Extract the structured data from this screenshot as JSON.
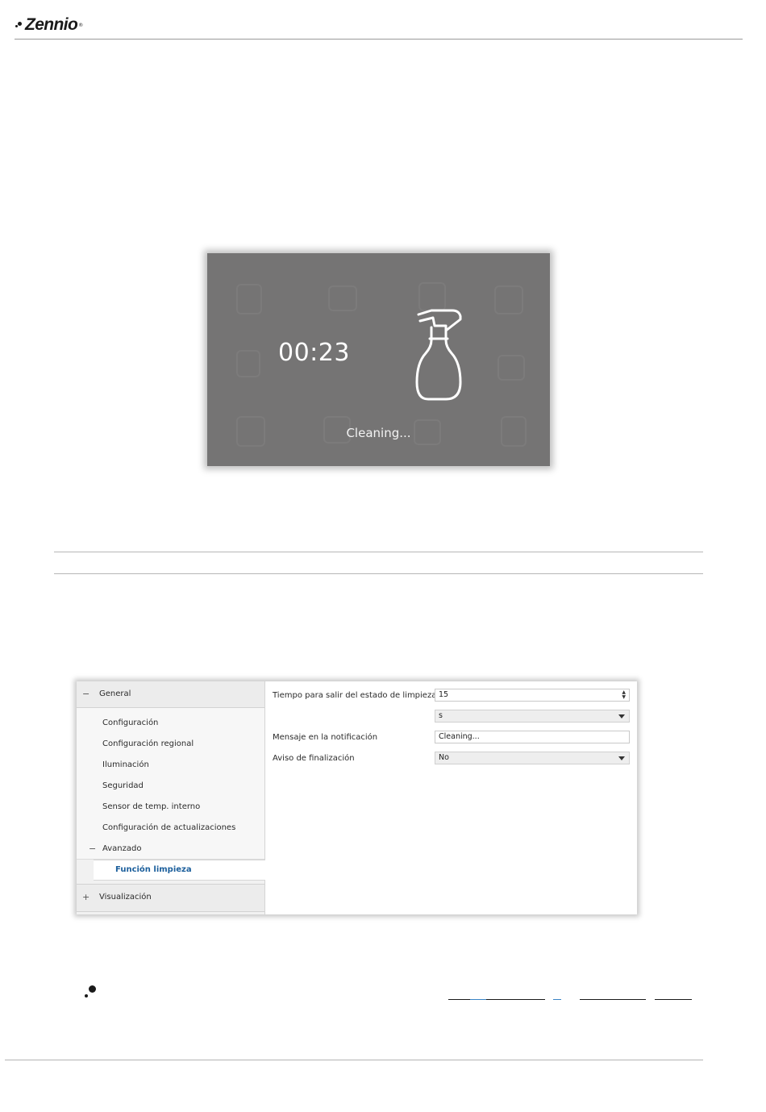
{
  "header": {
    "logo_text": "Zennio",
    "logo_mark": "®"
  },
  "cleaning_screen": {
    "countdown": "00:23",
    "message": "Cleaning...",
    "icon": "spray-bottle-icon",
    "background_color": "#757474"
  },
  "settings": {
    "tree": {
      "general": "General",
      "items": [
        "Configuración",
        "Configuración regional",
        "Iluminación",
        "Seguridad",
        "Sensor de temp. interno",
        "Configuración de actualizaciones"
      ],
      "advanced": "Avanzado",
      "selected": "Función limpieza",
      "visualization": "Visualización",
      "collapse_sign": "−",
      "expand_sign": "+"
    },
    "fields": {
      "exit_time_label": "Tiempo para salir del estado de limpieza",
      "exit_time_value": "15",
      "exit_time_unit": "s",
      "message_label": "Mensaje en la notificación",
      "message_value": "Cleaning...",
      "end_warning_label": "Aviso de finalización",
      "end_warning_value": "No"
    },
    "selected_color": "#1c5f9c"
  }
}
